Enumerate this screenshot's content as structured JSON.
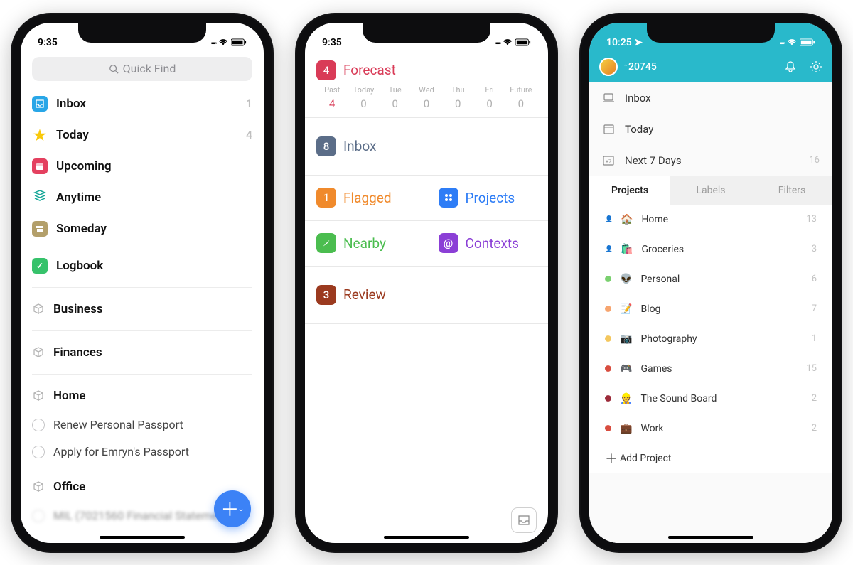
{
  "phone1": {
    "time": "9:35",
    "search_placeholder": "Quick Find",
    "items": [
      {
        "label": "Inbox",
        "count": "1",
        "color": "#28a6e7",
        "icon": "inbox"
      },
      {
        "label": "Today",
        "count": "4",
        "color": "#f9c90a",
        "icon": "star"
      },
      {
        "label": "Upcoming",
        "count": "",
        "color": "#e4405f",
        "icon": "calendar"
      },
      {
        "label": "Anytime",
        "count": "",
        "color": "#1aa99a",
        "icon": "stack"
      },
      {
        "label": "Someday",
        "count": "",
        "color": "#b39f6a",
        "icon": "archive"
      },
      {
        "label": "Logbook",
        "count": "",
        "color": "#36c26b",
        "icon": "check"
      }
    ],
    "areas": [
      {
        "label": "Business"
      },
      {
        "label": "Finances"
      },
      {
        "label": "Home",
        "tasks": [
          "Renew Personal Passport",
          "Apply for Emryn's Passport"
        ]
      },
      {
        "label": "Office"
      }
    ],
    "blurred_task": "MIL (7021560 Financial Statements"
  },
  "phone2": {
    "time": "9:35",
    "forecast": {
      "count": "4",
      "label": "Forecast",
      "days": [
        {
          "name": "Past",
          "n": "4",
          "past": true
        },
        {
          "name": "Today",
          "n": "0"
        },
        {
          "name": "Tue",
          "n": "0"
        },
        {
          "name": "Wed",
          "n": "0"
        },
        {
          "name": "Thu",
          "n": "0"
        },
        {
          "name": "Fri",
          "n": "0"
        },
        {
          "name": "Future",
          "n": "0"
        }
      ]
    },
    "inbox": {
      "count": "8",
      "label": "Inbox"
    },
    "flagged": {
      "count": "1",
      "label": "Flagged"
    },
    "projects": {
      "label": "Projects"
    },
    "nearby": {
      "label": "Nearby"
    },
    "contexts": {
      "label": "Contexts"
    },
    "review": {
      "count": "3",
      "label": "Review"
    }
  },
  "phone3": {
    "time": "10:25",
    "karma": "20745",
    "top": [
      {
        "label": "Inbox",
        "icon": "laptop",
        "count": ""
      },
      {
        "label": "Today",
        "icon": "calendar",
        "count": ""
      },
      {
        "label": "Next 7 Days",
        "icon": "week",
        "count": "16"
      }
    ],
    "tabs": [
      "Projects",
      "Labels",
      "Filters"
    ],
    "active_tab": 0,
    "projects": [
      {
        "emoji": "🏠",
        "label": "Home",
        "count": "13",
        "color": "#8fd46b",
        "shared": true
      },
      {
        "emoji": "🛍️",
        "label": "Groceries",
        "count": "3",
        "color": "#f59282",
        "shared": true
      },
      {
        "emoji": "👽",
        "label": "Personal",
        "count": "6",
        "color": "#7ad06f"
      },
      {
        "emoji": "📝",
        "label": "Blog",
        "count": "7",
        "color": "#f7a56f"
      },
      {
        "emoji": "📷",
        "label": "Photography",
        "count": "1",
        "color": "#f4c75e"
      },
      {
        "emoji": "🎮",
        "label": "Games",
        "count": "15",
        "color": "#d84d3f"
      },
      {
        "emoji": "👷",
        "label": "The Sound Board",
        "count": "2",
        "color": "#9c2b3a"
      },
      {
        "emoji": "💼",
        "label": "Work",
        "count": "2",
        "color": "#d84d3f"
      }
    ],
    "add_project": "Add Project"
  }
}
